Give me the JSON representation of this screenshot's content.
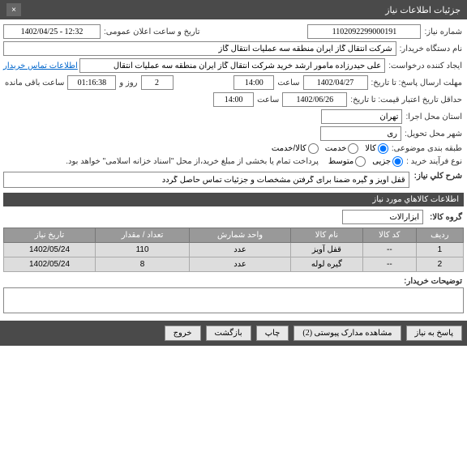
{
  "header": {
    "title": "جزئیات اطلاعات نیاز",
    "close": "×"
  },
  "form": {
    "niaz_num_label": "شماره نیاز:",
    "niaz_num": "1102092299000191",
    "announce_label": "تاریخ و ساعت اعلان عمومی:",
    "announce_value": "1402/04/25 - 12:32",
    "buyer_label": "نام دستگاه خریدار:",
    "buyer_value": "شرکت انتقال گاز ایران منطقه سه عملیات انتقال گاز",
    "creator_label": "ایجاد کننده درخواست:",
    "creator_value": "علی حیدرزاده مامور ارشد خرید شرکت انتقال گاز ایران منطقه سه عملیات انتقال",
    "contact_link": "اطلاعات تماس خریدار",
    "deadline_label": "مهلت ارسال پاسخ: تا تاریخ:",
    "deadline_date": "1402/04/27",
    "hour_label": "ساعت",
    "deadline_hour": "14:00",
    "day_label": "روز و",
    "day_value": "2",
    "remaining_label": "ساعت باقی مانده",
    "remaining_time": "01:16:38",
    "validity_label": "حداقل تاریخ اعتبار قیمت: تا تاریخ:",
    "validity_date": "1402/06/26",
    "validity_hour": "14:00",
    "exec_label": "استان محل اجرا:",
    "exec_value": "تهران",
    "delivery_label": "شهر محل تحویل:",
    "delivery_value": "ری",
    "category_label": "طبقه بندی موضوعی:",
    "cat_goods": "کالا",
    "cat_service": "خدمت",
    "cat_both": "کالا/خدمت",
    "process_label": "نوع فرآیند خرید :",
    "proc_partial": "جزیی",
    "proc_medium": "متوسط",
    "process_note": "پرداخت تمام یا بخشی از مبلغ خرید،از محل \"اسناد خزانه اسلامی\" خواهد بود."
  },
  "sharh": {
    "label": "شرح کلي نياز:",
    "value": "قفل آویز و گیره ضمنا برای گرفتن مشخصات و جزئیات تماس حاصل گردد"
  },
  "goods": {
    "section_title": "اطلاعات کالاهاي مورد نياز",
    "group_label": "گروه کالا:",
    "group_value": "ابزارآلات",
    "cols": {
      "row": "ردیف",
      "code": "کد کالا",
      "name": "نام کالا",
      "unit": "واحد شمارش",
      "qty": "تعداد / مقدار",
      "date": "تاریخ نیاز"
    },
    "rows": [
      {
        "n": "1",
        "code": "--",
        "name": "قفل آویز",
        "unit": "عدد",
        "qty": "110",
        "date": "1402/05/24"
      },
      {
        "n": "2",
        "code": "--",
        "name": "گیره لوله",
        "unit": "عدد",
        "qty": "8",
        "date": "1402/05/24"
      }
    ]
  },
  "notes": {
    "label": "توضیحات خریدار:"
  },
  "footer": {
    "reply": "پاسخ به نیاز",
    "docs": "مشاهده مدارک پیوستی (2)",
    "print": "چاپ",
    "back": "بازگشت",
    "exit": "خروج"
  }
}
